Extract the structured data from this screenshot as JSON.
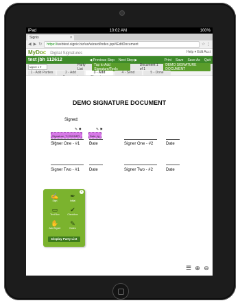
{
  "device": {
    "carrier": "iPad",
    "time": "10:02 AM",
    "battery": "100%"
  },
  "browser": {
    "tab_title": "Signix",
    "tab_close": "×",
    "url_https": "https://",
    "url_rest": "webtest.signix.biz/us/wizard/index.jsp#/EditDocument",
    "url_icons": "☆ ⋮"
  },
  "app": {
    "logo_my": "MyDo",
    "logo_c": "c",
    "subtitle": "Digital Signatures",
    "right_info": "Help ▾   Edit Acct"
  },
  "greenbar": {
    "doc_name": "test jbh 112612",
    "prev": "◀ Previous Step",
    "next": "Next Step ▶",
    "print": "Print",
    "save": "Save",
    "save_as": "Save As",
    "quit": "Quit"
  },
  "partybar": {
    "party_list": "Party List",
    "tap_hint": "Tap to Add Signature/Tools",
    "doc_count": "Document 1 of 1",
    "doc_select": "DEMO SIGNATURE DOCUMENT",
    "signer_value": "signer 1 ▾"
  },
  "steps": [
    "1 - Add Parties",
    "2 - Add Document",
    "3 - Add Signatures",
    "4 - Send",
    "5 - Done"
  ],
  "document": {
    "title": "DEMO SIGNATURE DOCUMENT",
    "signed_label": "Signed:",
    "field1_text": "Signature, TJ SIGNER 1 8",
    "field2_text": "Date, tg 1",
    "field_icons": "✎ ✖",
    "signer_one_1": "Signer One - #1",
    "date": "Date",
    "signer_one_2": "Signer One - #2",
    "signer_two_1": "Signer Two - #1",
    "signer_two_2": "Signer Two - #2"
  },
  "tool_panel": {
    "close": "×",
    "tools": [
      {
        "label": "Sign",
        "glyph": "✍"
      },
      {
        "label": "Initial",
        "glyph": "✒"
      },
      {
        "label": "Text Box",
        "glyph": "▭"
      },
      {
        "label": "Checkbox",
        "glyph": "✔"
      },
      {
        "label": "Add Signer",
        "glyph": "✋"
      },
      {
        "label": "Notes",
        "glyph": "✎"
      }
    ],
    "display_party_list": "Display Party List"
  },
  "bottom_tools": {
    "list": "☰",
    "zoom_in": "⊕",
    "zoom_out": "⊖"
  },
  "colors": {
    "green_bar": "#3e8a2a",
    "panel_green": "#7bb32e",
    "sig_field": "#d879e8"
  }
}
